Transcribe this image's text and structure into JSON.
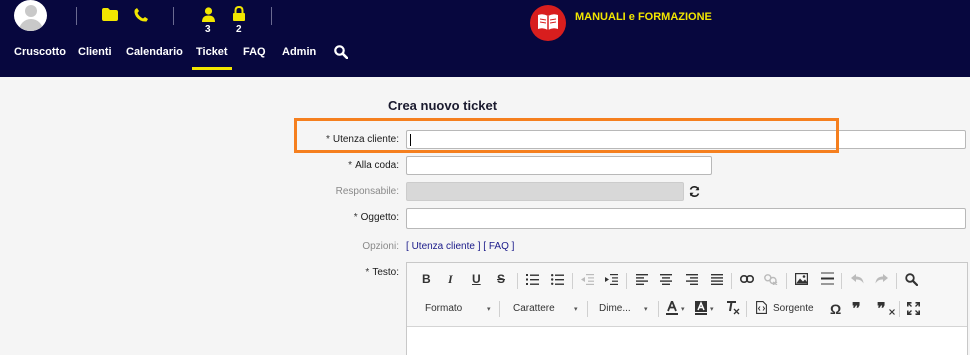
{
  "header": {
    "user_count": "3",
    "lock_count": "2",
    "brand_title": "MANUALI e FORMAZIONE"
  },
  "nav": {
    "items": [
      {
        "label": "Cruscotto"
      },
      {
        "label": "Clienti"
      },
      {
        "label": "Calendario"
      },
      {
        "label": "Ticket"
      },
      {
        "label": "FAQ"
      },
      {
        "label": "Admin"
      }
    ],
    "active": "Ticket"
  },
  "form": {
    "title": "Crea nuovo ticket",
    "required_mark": "*",
    "fields": {
      "utenza": {
        "label": "Utenza cliente:",
        "value": ""
      },
      "coda": {
        "label": "Alla coda:",
        "value": ""
      },
      "responsabile": {
        "label": "Responsabile:",
        "value": ""
      },
      "oggetto": {
        "label": "Oggetto:",
        "value": ""
      },
      "opzioni": {
        "label": "Opzioni:"
      },
      "testo": {
        "label": "Testo:"
      }
    },
    "options_links": {
      "open": "[",
      "utenza": "Utenza cliente",
      "mid": "] [",
      "faq": "FAQ",
      "close": "]"
    }
  },
  "editor": {
    "toolbar": {
      "bold": "B",
      "italic": "I",
      "underline": "U",
      "strike": "S",
      "format": "Formato",
      "font": "Carattere",
      "size": "Dime...",
      "source": "Sorgente",
      "omega": "Ω",
      "quote": "❞",
      "dd_arrow": "▾"
    }
  },
  "colors": {
    "header_bg": "#07073e",
    "accent_yellow": "#f2e600",
    "highlight_orange": "#f57f1e",
    "brand_red": "#d81e1e"
  },
  "icons": [
    "user-avatar-icon",
    "folder-icon",
    "phone-icon",
    "user-icon",
    "lock-icon",
    "book-icon",
    "search-icon",
    "refresh-icon"
  ]
}
